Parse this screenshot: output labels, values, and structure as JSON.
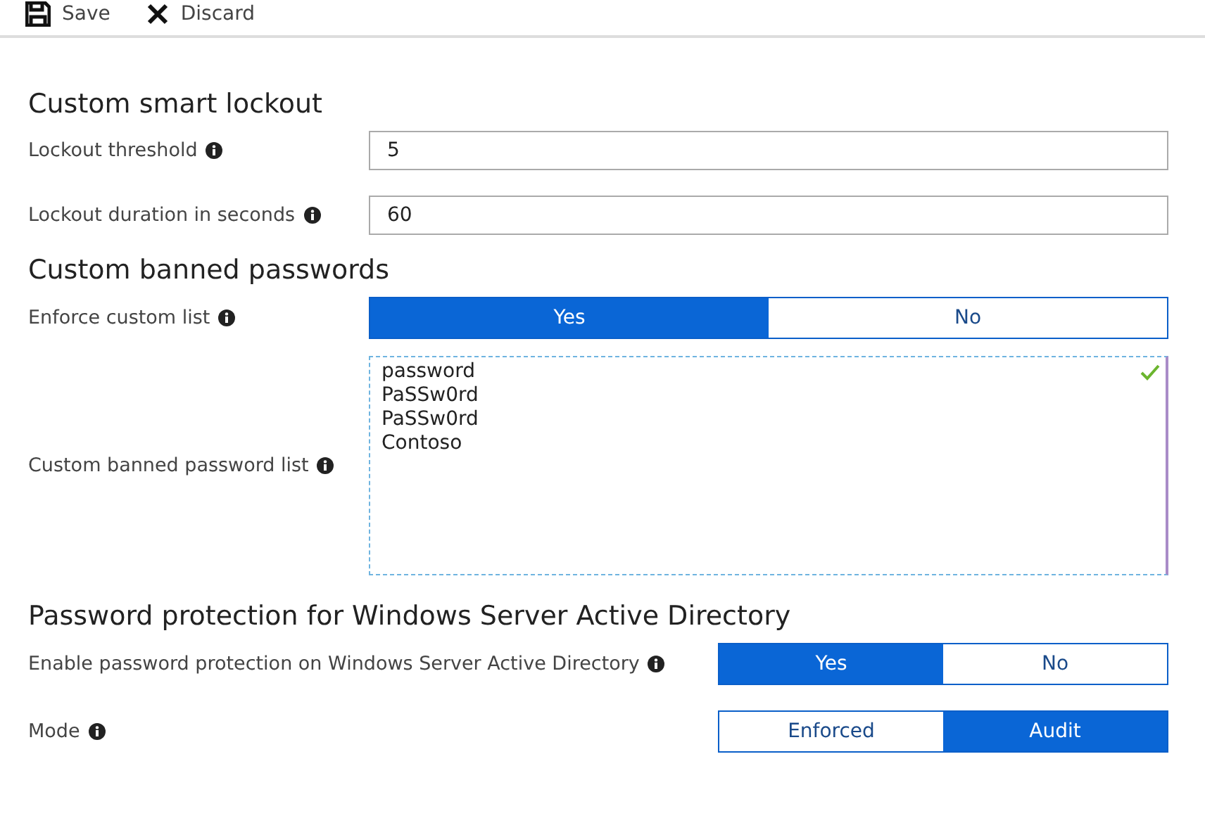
{
  "toolbar": [
    {
      "kind": "save",
      "label": "Save"
    },
    {
      "kind": "discard",
      "label": "Discard"
    }
  ],
  "smart_lockout": {
    "title": "Custom smart lockout",
    "fields": [
      {
        "label": "Lockout threshold",
        "value": "5"
      },
      {
        "label": "Lockout duration in seconds",
        "value": "60"
      }
    ]
  },
  "banned_passwords": {
    "title": "Custom banned passwords",
    "enforce": {
      "label": "Enforce custom list",
      "options": [
        {
          "label": "Yes",
          "selected": true
        },
        {
          "label": "No",
          "selected": false
        }
      ]
    },
    "list": {
      "label": "Custom banned password list",
      "lines": [
        "password",
        "PaSSw0rd",
        "PaSSw0rd",
        "Contoso"
      ],
      "valid": true
    }
  },
  "windows_server": {
    "title": "Password protection for Windows Server Active Directory",
    "toggles": [
      {
        "label": "Enable password protection on Windows Server Active Directory",
        "options": [
          {
            "label": "Yes",
            "selected": true
          },
          {
            "label": "No",
            "selected": false
          }
        ]
      },
      {
        "label": "Mode",
        "options": [
          {
            "label": "Enforced",
            "selected": false
          },
          {
            "label": "Audit",
            "selected": true
          }
        ]
      }
    ]
  }
}
